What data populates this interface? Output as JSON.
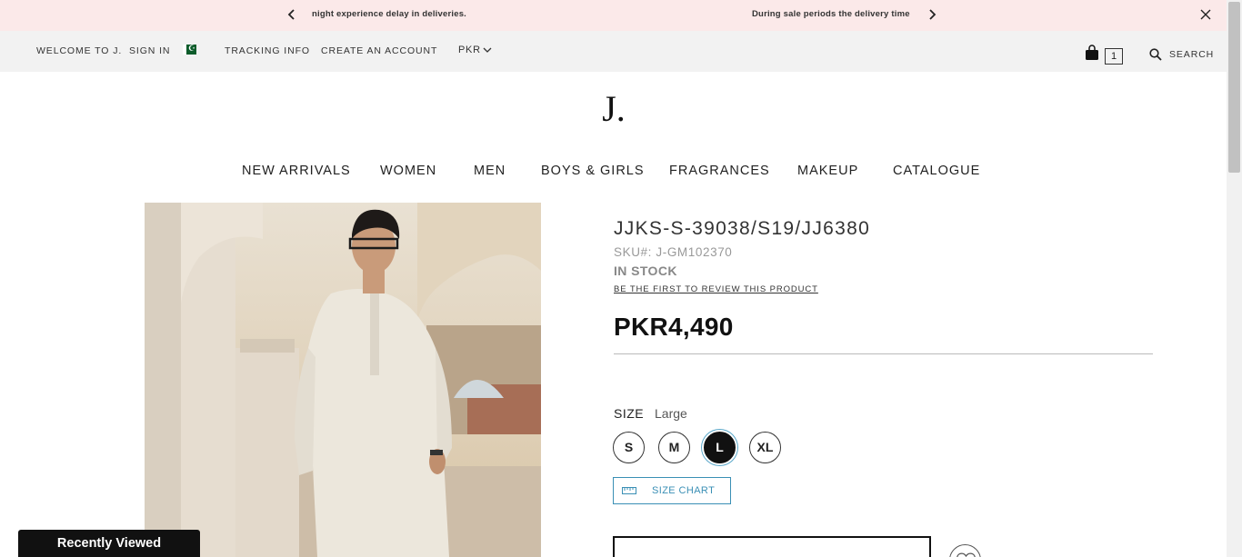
{
  "announcement": {
    "messages": [
      "night experience delay in deliveries.",
      "During sale periods the delivery time"
    ]
  },
  "topbar": {
    "welcome": "WELCOME TO J.",
    "sign_in": "SIGN IN",
    "tracking": "TRACKING INFO",
    "create_account": "CREATE AN ACCOUNT",
    "currency": "PKR",
    "cart_count": "1",
    "search_label": "SEARCH"
  },
  "logo": "J.",
  "nav": [
    "NEW ARRIVALS",
    "WOMEN",
    "MEN",
    "BOYS & GIRLS",
    "FRAGRANCES",
    "MAKEUP",
    "CATALOGUE"
  ],
  "product": {
    "title": "JJKS-S-39038/S19/JJ6380",
    "sku": "SKU#:  J-GM102370",
    "stock": "IN STOCK",
    "review_link": "BE THE FIRST TO REVIEW THIS PRODUCT",
    "price": "PKR4,490",
    "size_label": "SIZE",
    "size_value": "Large",
    "sizes": [
      "S",
      "M",
      "L",
      "XL"
    ],
    "selected_size": "L",
    "size_chart": "SIZE CHART"
  },
  "recently_viewed": "Recently Viewed",
  "colors": {
    "announce_bg": "#fbe9e9",
    "topbar_bg": "#f2f2f2",
    "accent": "#3a8fb5"
  }
}
